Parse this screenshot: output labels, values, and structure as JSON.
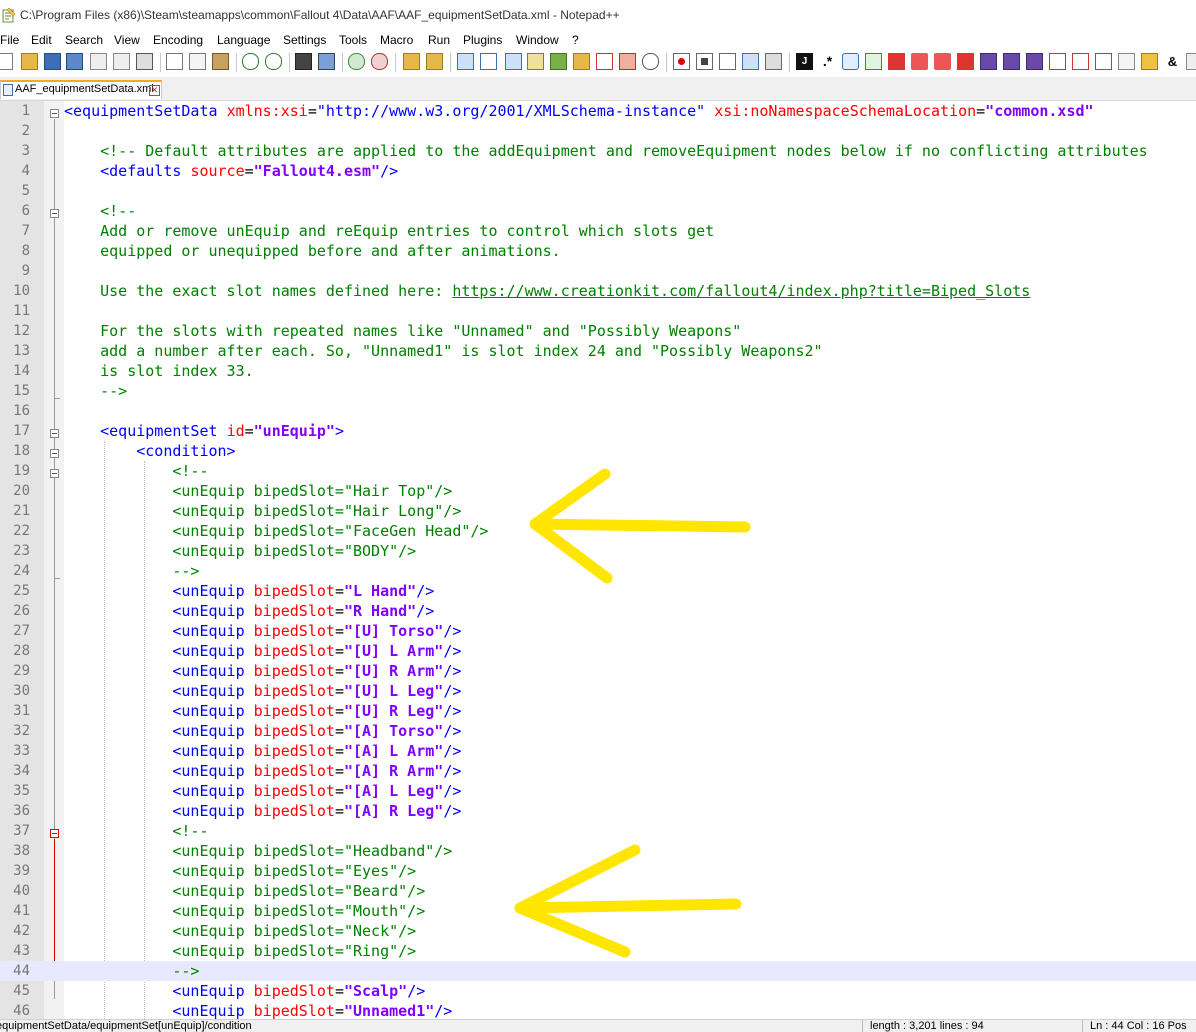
{
  "window": {
    "title": "C:\\Program Files (x86)\\Steam\\steamapps\\common\\Fallout 4\\Data\\AAF\\AAF_equipmentSetData.xml - Notepad++"
  },
  "menu": [
    "File",
    "Edit",
    "Search",
    "View",
    "Encoding",
    "Language",
    "Settings",
    "Tools",
    "Macro",
    "Run",
    "Plugins",
    "Window",
    "?"
  ],
  "tab": {
    "label": "AAF_equipmentSetData.xml",
    "close": "✕"
  },
  "colors": {
    "tag": "#0000ff",
    "attribute": "#ff0000",
    "value": "#8000ff",
    "comment": "#008000",
    "highlight_arrow": "#ffe600",
    "current_line": "#e8e8ff"
  },
  "lines": [
    {
      "n": "1",
      "s": [
        [
          "t",
          "<equipmentSetData "
        ],
        [
          "a",
          "xmlns:xsi"
        ],
        [
          "p",
          "="
        ],
        [
          "u",
          "\"http://www.w3.org/2001/XMLSchema-instance\""
        ],
        [
          "a",
          " xsi:noNamespaceSchemaLocation"
        ],
        [
          "p",
          "="
        ],
        [
          "v",
          "\"common.xsd\""
        ]
      ]
    },
    {
      "n": "2",
      "s": []
    },
    {
      "n": "3",
      "s": [
        [
          "c",
          "    <!-- Default attributes are applied to the addEquipment and removeEquipment nodes below if no conflicting attributes"
        ]
      ]
    },
    {
      "n": "4",
      "s": [
        [
          "t",
          "    <defaults "
        ],
        [
          "a",
          "source"
        ],
        [
          "p",
          "="
        ],
        [
          "v",
          "\"Fallout4.esm\""
        ],
        [
          "t",
          "/>"
        ]
      ]
    },
    {
      "n": "5",
      "s": []
    },
    {
      "n": "6",
      "s": [
        [
          "c",
          "    <!--"
        ]
      ]
    },
    {
      "n": "7",
      "s": [
        [
          "c",
          "    Add or remove unEquip and reEquip entries to control which slots get"
        ]
      ]
    },
    {
      "n": "8",
      "s": [
        [
          "c",
          "    equipped or unequipped before and after animations."
        ]
      ]
    },
    {
      "n": "9",
      "s": []
    },
    {
      "n": "10",
      "s": [
        [
          "c",
          "    Use the exact slot names defined here: "
        ],
        [
          "l",
          "https://www.creationkit.com/fallout4/index.php?title=Biped_Slots"
        ]
      ]
    },
    {
      "n": "11",
      "s": []
    },
    {
      "n": "12",
      "s": [
        [
          "c",
          "    For the slots with repeated names like \"Unnamed\" and \"Possibly Weapons\""
        ]
      ]
    },
    {
      "n": "13",
      "s": [
        [
          "c",
          "    add a number after each. So, \"Unnamed1\" is slot index 24 and \"Possibly Weapons2\""
        ]
      ]
    },
    {
      "n": "14",
      "s": [
        [
          "c",
          "    is slot index 33."
        ]
      ]
    },
    {
      "n": "15",
      "s": [
        [
          "c",
          "    -->"
        ]
      ]
    },
    {
      "n": "16",
      "s": []
    },
    {
      "n": "17",
      "s": [
        [
          "t",
          "    <equipmentSet "
        ],
        [
          "a",
          "id"
        ],
        [
          "p",
          "="
        ],
        [
          "v",
          "\"unEquip\""
        ],
        [
          "t",
          ">"
        ]
      ]
    },
    {
      "n": "18",
      "s": [
        [
          "t",
          "        <condition>"
        ]
      ]
    },
    {
      "n": "19",
      "s": [
        [
          "c",
          "            <!--"
        ]
      ]
    },
    {
      "n": "20",
      "s": [
        [
          "c",
          "            <unEquip bipedSlot=\"Hair Top\"/>"
        ]
      ]
    },
    {
      "n": "21",
      "s": [
        [
          "c",
          "            <unEquip bipedSlot=\"Hair Long\"/>"
        ]
      ]
    },
    {
      "n": "22",
      "s": [
        [
          "c",
          "            <unEquip bipedSlot=\"FaceGen Head\"/>"
        ]
      ]
    },
    {
      "n": "23",
      "s": [
        [
          "c",
          "            <unEquip bipedSlot=\"BODY\"/>"
        ]
      ]
    },
    {
      "n": "24",
      "s": [
        [
          "c",
          "            -->"
        ]
      ]
    },
    {
      "n": "25",
      "s": [
        [
          "t",
          "            <unEquip "
        ],
        [
          "a",
          "bipedSlot"
        ],
        [
          "p",
          "="
        ],
        [
          "v",
          "\"L Hand\""
        ],
        [
          "t",
          "/>"
        ]
      ]
    },
    {
      "n": "26",
      "s": [
        [
          "t",
          "            <unEquip "
        ],
        [
          "a",
          "bipedSlot"
        ],
        [
          "p",
          "="
        ],
        [
          "v",
          "\"R Hand\""
        ],
        [
          "t",
          "/>"
        ]
      ]
    },
    {
      "n": "27",
      "s": [
        [
          "t",
          "            <unEquip "
        ],
        [
          "a",
          "bipedSlot"
        ],
        [
          "p",
          "="
        ],
        [
          "v",
          "\"[U] Torso\""
        ],
        [
          "t",
          "/>"
        ]
      ]
    },
    {
      "n": "28",
      "s": [
        [
          "t",
          "            <unEquip "
        ],
        [
          "a",
          "bipedSlot"
        ],
        [
          "p",
          "="
        ],
        [
          "v",
          "\"[U] L Arm\""
        ],
        [
          "t",
          "/>"
        ]
      ]
    },
    {
      "n": "29",
      "s": [
        [
          "t",
          "            <unEquip "
        ],
        [
          "a",
          "bipedSlot"
        ],
        [
          "p",
          "="
        ],
        [
          "v",
          "\"[U] R Arm\""
        ],
        [
          "t",
          "/>"
        ]
      ]
    },
    {
      "n": "30",
      "s": [
        [
          "t",
          "            <unEquip "
        ],
        [
          "a",
          "bipedSlot"
        ],
        [
          "p",
          "="
        ],
        [
          "v",
          "\"[U] L Leg\""
        ],
        [
          "t",
          "/>"
        ]
      ]
    },
    {
      "n": "31",
      "s": [
        [
          "t",
          "            <unEquip "
        ],
        [
          "a",
          "bipedSlot"
        ],
        [
          "p",
          "="
        ],
        [
          "v",
          "\"[U] R Leg\""
        ],
        [
          "t",
          "/>"
        ]
      ]
    },
    {
      "n": "32",
      "s": [
        [
          "t",
          "            <unEquip "
        ],
        [
          "a",
          "bipedSlot"
        ],
        [
          "p",
          "="
        ],
        [
          "v",
          "\"[A] Torso\""
        ],
        [
          "t",
          "/>"
        ]
      ]
    },
    {
      "n": "33",
      "s": [
        [
          "t",
          "            <unEquip "
        ],
        [
          "a",
          "bipedSlot"
        ],
        [
          "p",
          "="
        ],
        [
          "v",
          "\"[A] L Arm\""
        ],
        [
          "t",
          "/>"
        ]
      ]
    },
    {
      "n": "34",
      "s": [
        [
          "t",
          "            <unEquip "
        ],
        [
          "a",
          "bipedSlot"
        ],
        [
          "p",
          "="
        ],
        [
          "v",
          "\"[A] R Arm\""
        ],
        [
          "t",
          "/>"
        ]
      ]
    },
    {
      "n": "35",
      "s": [
        [
          "t",
          "            <unEquip "
        ],
        [
          "a",
          "bipedSlot"
        ],
        [
          "p",
          "="
        ],
        [
          "v",
          "\"[A] L Leg\""
        ],
        [
          "t",
          "/>"
        ]
      ]
    },
    {
      "n": "36",
      "s": [
        [
          "t",
          "            <unEquip "
        ],
        [
          "a",
          "bipedSlot"
        ],
        [
          "p",
          "="
        ],
        [
          "v",
          "\"[A] R Leg\""
        ],
        [
          "t",
          "/>"
        ]
      ]
    },
    {
      "n": "37",
      "s": [
        [
          "c",
          "            <!--"
        ]
      ]
    },
    {
      "n": "38",
      "s": [
        [
          "c",
          "            <unEquip bipedSlot=\"Headband\"/>"
        ]
      ]
    },
    {
      "n": "39",
      "s": [
        [
          "c",
          "            <unEquip bipedSlot=\"Eyes\"/>"
        ]
      ]
    },
    {
      "n": "40",
      "s": [
        [
          "c",
          "            <unEquip bipedSlot=\"Beard\"/>"
        ]
      ]
    },
    {
      "n": "41",
      "s": [
        [
          "c",
          "            <unEquip bipedSlot=\"Mouth\"/>"
        ]
      ]
    },
    {
      "n": "42",
      "s": [
        [
          "c",
          "            <unEquip bipedSlot=\"Neck\"/>"
        ]
      ]
    },
    {
      "n": "43",
      "s": [
        [
          "c",
          "            <unEquip bipedSlot=\"Ring\"/>"
        ]
      ]
    },
    {
      "n": "44",
      "s": [
        [
          "c",
          "            -->"
        ]
      ],
      "current": true
    },
    {
      "n": "45",
      "s": [
        [
          "t",
          "            <unEquip "
        ],
        [
          "a",
          "bipedSlot"
        ],
        [
          "p",
          "="
        ],
        [
          "v",
          "\"Scalp\""
        ],
        [
          "t",
          "/>"
        ]
      ]
    },
    {
      "n": "46",
      "s": [
        [
          "t",
          "            <unEquip "
        ],
        [
          "a",
          "bipedSlot"
        ],
        [
          "p",
          "="
        ],
        [
          "v",
          "\"Unnamed1\""
        ],
        [
          "t",
          "/>"
        ]
      ]
    }
  ],
  "status": {
    "path": "equipmentSetData/equipmentSet[unEquip]/condition",
    "length": "length : 3,201    lines : 94",
    "position": "Ln : 44    Col : 16    Pos"
  }
}
